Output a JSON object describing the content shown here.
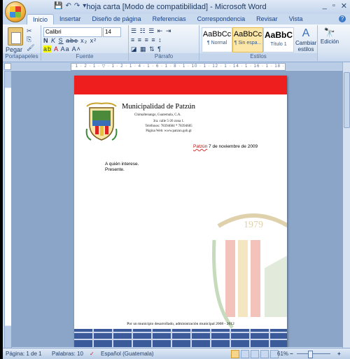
{
  "window": {
    "title": "hoja carta [Modo de compatibilidad] - Microsoft Word",
    "controls": [
      "_",
      "▫",
      "✕"
    ]
  },
  "tabs": [
    "Inicio",
    "Insertar",
    "Diseño de página",
    "Referencias",
    "Correspondencia",
    "Revisar",
    "Vista"
  ],
  "ribbon": {
    "clipboard": {
      "paste_label": "Pegar",
      "group_label": "Portapapeles"
    },
    "font": {
      "font_name": "Calibri",
      "font_size": "14",
      "group_label": "Fuente"
    },
    "paragraph": {
      "group_label": "Párrafo"
    },
    "styles": {
      "group_label": "Estilos",
      "items": [
        {
          "preview": "AaBbCc",
          "name": "¶ Normal"
        },
        {
          "preview": "AaBbCc",
          "name": "¶ Sin espa..."
        },
        {
          "preview": "AaBbC",
          "name": "Título 1"
        }
      ],
      "change_styles": "Cambiar estilos"
    },
    "editing": {
      "label": "Edición"
    }
  },
  "document": {
    "org_name": "Municipalidad de Patzún",
    "org_sub": "Chimaltenango, Guatemala, C.A.",
    "address_lines": [
      "3ra. calle 5-26 zona 1.",
      "Teléfonos: 78394684  *  78394685",
      "Página Web: www.patzun.gob.gt"
    ],
    "date_place": "Patzún",
    "date_rest": " 7 de noviembre de 2009",
    "greeting_1": "A quién interese.",
    "greeting_2": "Presente.",
    "watermark_year": "1979",
    "footer": "Por un municipio desarrollado, administración municipal 2008 - 2012"
  },
  "status_bar": {
    "page": "Página: 1 de 1",
    "words": "Palabras: 10",
    "language": "Español (Guatemala)",
    "zoom": "61%"
  }
}
